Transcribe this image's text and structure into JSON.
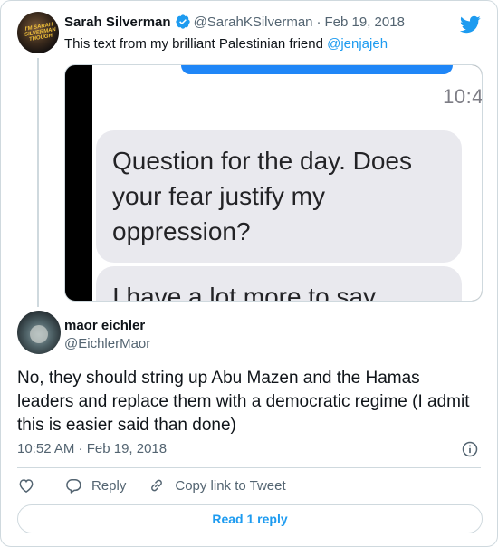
{
  "parent_tweet": {
    "display_name": "Sarah Silverman",
    "handle": "@SarahKSilverman",
    "separator": "·",
    "date": "Feb 19, 2018",
    "text_before_mention": "This text from my brilliant Palestinian friend ",
    "mention": "@jenjajeh",
    "avatar_text": "I'M SARAH SILVERMAN THOUGH",
    "media": {
      "time": "10:4",
      "message_1": "Question for the day. Does your fear justify my oppression?",
      "message_2": "I have a lot more to say"
    }
  },
  "reply_tweet": {
    "display_name": "maor eichler",
    "handle": "@EichlerMaor",
    "text": "No, they should string up Abu Mazen and the Hamas leaders and replace them with a democratic regime (I admit this is easier said than done)",
    "timestamp": "10:52 AM · Feb 19, 2018"
  },
  "actions": {
    "reply_label": "Reply",
    "copy_link_label": "Copy link to Tweet"
  },
  "read_replies_label": "Read 1 reply",
  "colors": {
    "accent": "#1d9bf0",
    "muted": "#536471",
    "border": "#cfd9de",
    "imessage_blue": "#1f86f7",
    "imessage_gray": "#e9e9ee"
  },
  "icons": [
    "verified-badge-icon",
    "twitter-bird-icon",
    "info-icon",
    "heart-icon",
    "reply-icon",
    "link-icon"
  ]
}
